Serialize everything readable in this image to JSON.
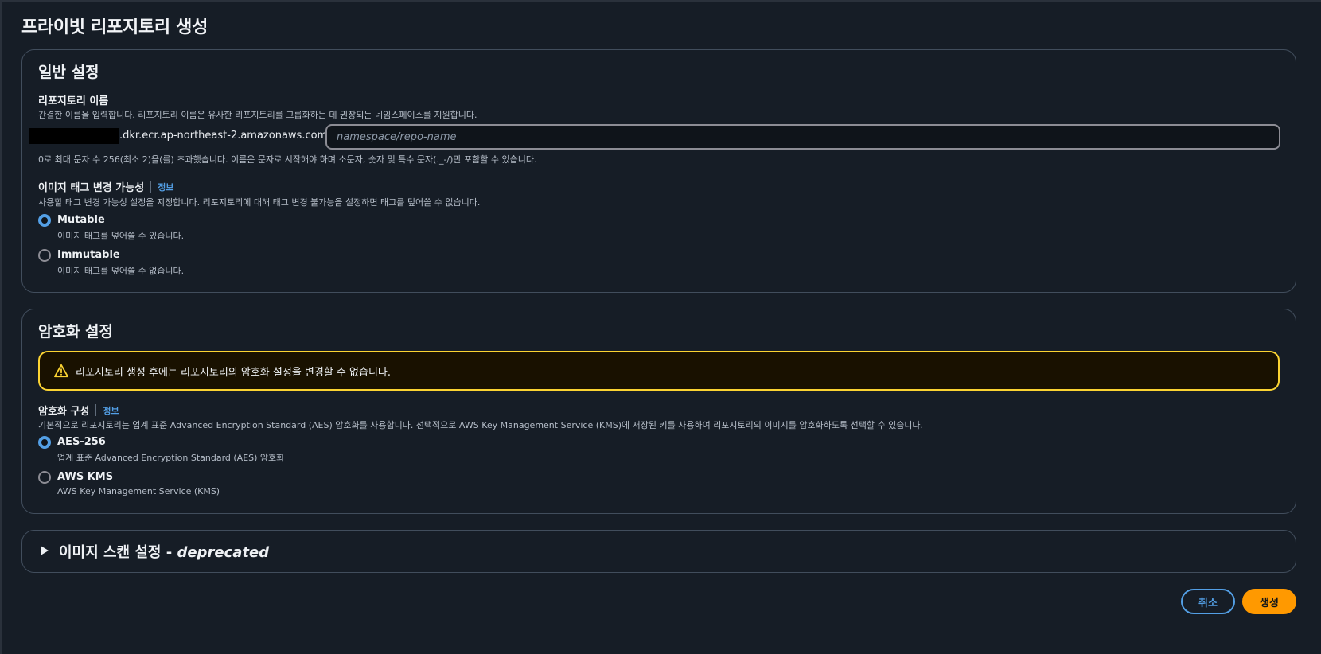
{
  "page": {
    "title": "프라이빗 리포지토리 생성"
  },
  "general": {
    "heading": "일반 설정",
    "repo_name_label": "리포지토리 이름",
    "repo_name_desc": "간결한 이름을 입력합니다. 리포지토리 이름은 유사한 리포지토리를 그룹화하는 데 권장되는 네임스페이스를 지원합니다.",
    "uri_prefix": ".dkr.ecr.ap-northeast-2.amazonaws.com/",
    "repo_input_value": "",
    "repo_input_placeholder": "namespace/repo-name",
    "repo_name_hint": "0로 최대 문자 수 256(최소 2)을(를) 초과했습니다. 이름은 문자로 시작해야 하며 소문자, 숫자 및 특수 문자(._-/)만 포함할 수 있습니다.",
    "tag_label": "이미지 태그 변경 가능성",
    "tag_info": "정보",
    "tag_desc": "사용할 태그 변경 가능성 설정을 지정합니다. 리포지토리에 대해 태그 변경 불가능을 설정하면 태그를 덮어쓸 수 없습니다.",
    "tag_options": [
      {
        "label": "Mutable",
        "desc": "이미지 태그를 덮어쓸 수 있습니다.",
        "selected": true
      },
      {
        "label": "Immutable",
        "desc": "이미지 태그를 덮어쓸 수 없습니다.",
        "selected": false
      }
    ]
  },
  "encryption": {
    "heading": "암호화 설정",
    "alert_text": "리포지토리 생성 후에는 리포지토리의 암호화 설정을 변경할 수 없습니다.",
    "config_label": "암호화 구성",
    "config_info": "정보",
    "config_desc": "기본적으로 리포지토리는 업계 표준 Advanced Encryption Standard (AES) 암호화를 사용합니다. 선택적으로 AWS Key Management Service (KMS)에 저장된 키를 사용하여 리포지토리의 이미지를 암호화하도록 선택할 수 있습니다.",
    "options": [
      {
        "label": "AES-256",
        "desc": "업계 표준 Advanced Encryption Standard (AES) 암호화",
        "selected": true
      },
      {
        "label": "AWS KMS",
        "desc": "AWS Key Management Service (KMS)",
        "selected": false
      }
    ]
  },
  "scan": {
    "title": "이미지 스캔 설정 - ",
    "title_suffix": "deprecated",
    "expanded": false
  },
  "actions": {
    "cancel_label": "취소",
    "create_label": "생성"
  },
  "colors": {
    "background": "#161d26",
    "link": "#539fe5",
    "primary_button": "#ff9900",
    "warning_border": "#fbd332"
  }
}
